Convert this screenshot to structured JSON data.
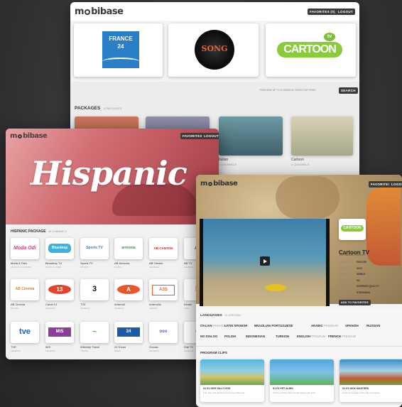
{
  "w1": {
    "logo": "mobibase",
    "buttons": [
      "FAVORITES (0)",
      "LOGOUT"
    ],
    "banners": [
      "FRANCE 24",
      "SONG",
      "CARTOON",
      "tv"
    ],
    "search_hint": "PREVIEW UP TO 6 SEARCH ITEMS FOR FREE",
    "search_button": "SEARCH",
    "packages_title": "PACKAGES",
    "packages_count": "8 PACKAGES",
    "cards": [
      {
        "title": "Italian",
        "sub": "2 CHANNELS"
      },
      {
        "title": "Cartoon",
        "sub": "2 CHANNELS"
      }
    ]
  },
  "w2": {
    "logo": "mobibase",
    "buttons": [
      "FAVORITES",
      "LOGOUT"
    ],
    "hero_title": "Hispanic",
    "section_title": "HISPANIC PACKAGE",
    "section_count": "40 CHANNELS",
    "channels": [
      {
        "logo": "Moda Odio",
        "name": "Moda & Odio",
        "sub": "LIFESTYLE & MORE"
      },
      {
        "logo": "Bluedeep",
        "name": "Bluedeep TV",
        "sub": "MUSIC & MORE"
      },
      {
        "logo": "Sports TV",
        "name": "Sports TV",
        "sub": "SPORTS"
      },
      {
        "logo": "armonía",
        "name": "AB Armonía",
        "sub": "MUSIC"
      },
      {
        "logo": "AB CANTÓN",
        "name": "AB Cantón",
        "sub": "GENERAL"
      },
      {
        "logo": "AB",
        "name": "AB TV",
        "sub": "GENERAL"
      },
      {
        "logo": "AB Cinema",
        "name": "AB Cinema",
        "sub": "MOVIES"
      },
      {
        "logo": "13",
        "name": "Canal 13",
        "sub": "GENERAL"
      },
      {
        "logo": "3",
        "name": "TV3",
        "sub": "GENERAL"
      },
      {
        "logo": "A",
        "name": "Antena3",
        "sub": "GENERAL"
      },
      {
        "logo": "A3S",
        "name": "Antena3s",
        "sub": "SERIES"
      },
      {
        "logo": "K",
        "name": "Kinder",
        "sub": "KIDS"
      },
      {
        "logo": "tve",
        "name": "TVE",
        "sub": "GENERAL"
      },
      {
        "logo": "MIS",
        "name": "MIS",
        "sub": "GENERAL"
      },
      {
        "logo": "~",
        "name": "Wikiduty Travel",
        "sub": "TRAVEL"
      },
      {
        "logo": "24",
        "name": "24 Horas",
        "sub": "NEWS"
      },
      {
        "logo": "ooo",
        "name": "Gocast",
        "sub": "GENERAL"
      },
      {
        "logo": "C",
        "name": "Dial TV",
        "sub": "GENERAL"
      }
    ]
  },
  "w3": {
    "logo": "mobibase",
    "buttons": [
      "FAVORITES",
      "LOGOUT"
    ],
    "thumb": "CARTOON",
    "channel_title": "Cartoon TV",
    "channel_badge": "kids",
    "channel_sub": "The cartoon channel",
    "info": [
      {
        "k": "LANGUAGE",
        "v": "ENGLISH"
      },
      {
        "k": "GENRE",
        "v": "KIDS"
      },
      {
        "k": "FORMAT",
        "v": "MOBILE"
      },
      {
        "k": "RESOLUTION",
        "v": "HD"
      },
      {
        "k": "QUALITY",
        "v": "SUPERIOR QUALITY"
      },
      {
        "k": "TYPE",
        "v": "STREAMING"
      }
    ],
    "add_button": "ADD TO FAVORITES",
    "languages_title": "LANGUAGES",
    "languages_count": "15 VERSIONS",
    "languages_row1": [
      {
        "name": "ITALIAN",
        "tag": "PREMIUM"
      },
      {
        "name": "LATIN SPANISH",
        "tag": ""
      },
      {
        "name": "BRAZILIAN PORTUGUESE",
        "tag": ""
      },
      {
        "name": "ARABIC",
        "tag": "PREMIUM"
      },
      {
        "name": "SPANISH",
        "tag": ""
      },
      {
        "name": "RUSSIAN",
        "tag": ""
      }
    ],
    "languages_row2": [
      {
        "name": "NO DIALOG",
        "tag": ""
      },
      {
        "name": "POLISH",
        "tag": ""
      },
      {
        "name": "INDONESIAN",
        "tag": ""
      },
      {
        "name": "TURKISH",
        "tag": ""
      },
      {
        "name": "ENGLISH",
        "tag": "PREMIUM"
      },
      {
        "name": "FRENCH",
        "tag": "PREMIUM"
      }
    ],
    "clips_title": "PROGRAM CLIPS",
    "clips": [
      {
        "title": "S1 E1 DIVE SILLY DIVE",
        "sub": "Fun, fish, and colorful adventures of the sea"
      },
      {
        "title": "S1 E1 PET ALIEN",
        "sub": "Tommy and his alien friends explore the town"
      },
      {
        "title": "S1 E1 NICK MASTERS",
        "sub": "A tale of courage in the land of dragons"
      }
    ]
  },
  "colors": {
    "accent": "#3a3a3a",
    "bg": "#2f2f31"
  }
}
